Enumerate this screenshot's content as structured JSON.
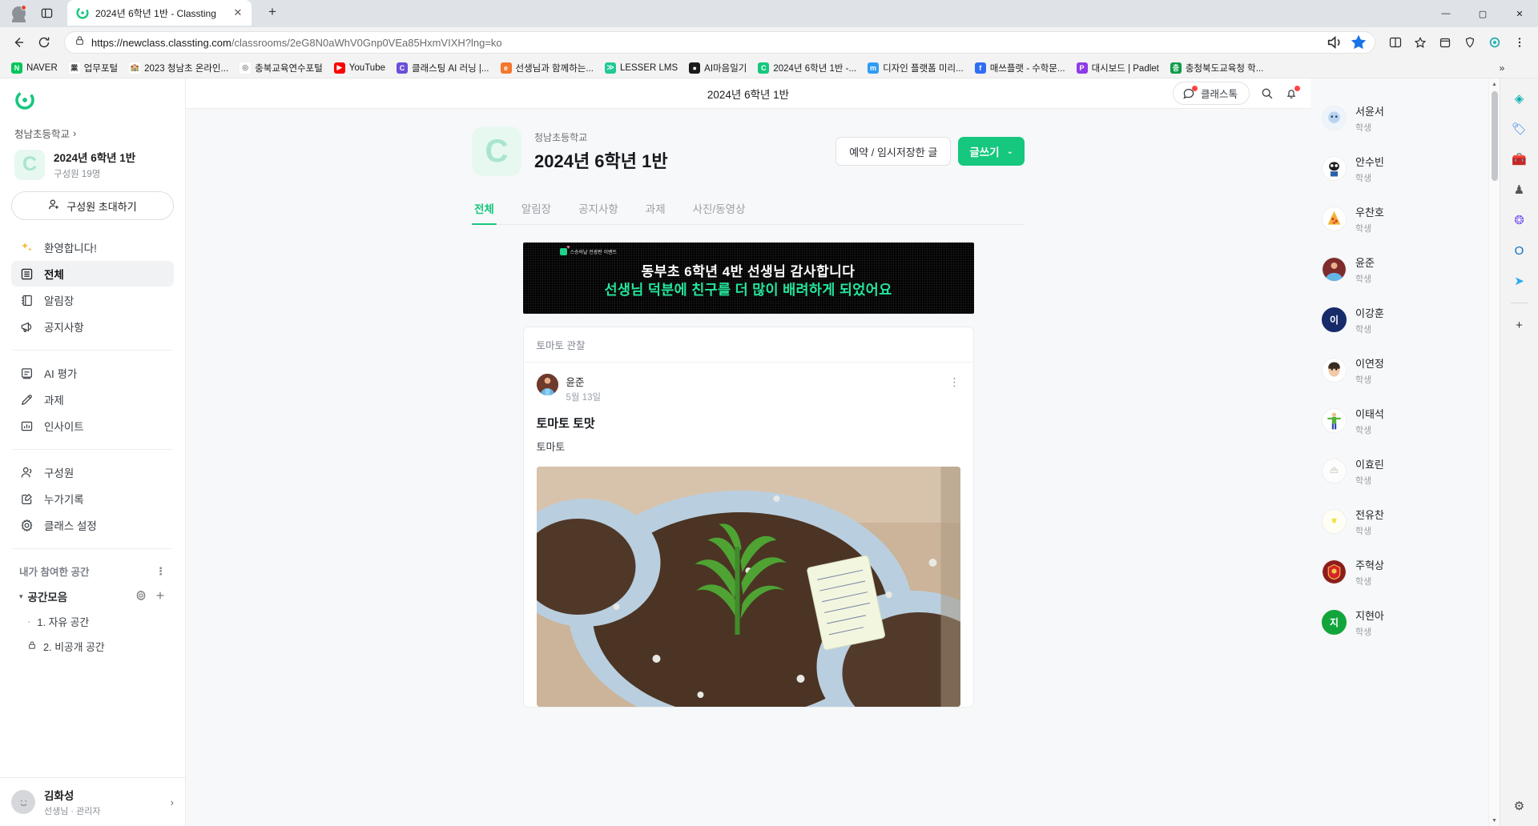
{
  "browser": {
    "tab": {
      "title": "2024년 6학년 1반 - Classting",
      "favicon": "classting-icon"
    },
    "newtab_label": "+",
    "window_controls": {
      "minimize": "—",
      "maximize": "▢",
      "close": "✕"
    },
    "url_secure": "https://newclass.classting.com",
    "url_path": "/classrooms/2eG8N0aWhV0Gnp0VEa85HxmVIXH?lng=ko",
    "bookmarks": [
      {
        "label": "NAVER",
        "icon": "naver-icon",
        "color": "#03c75a",
        "glyph": "N"
      },
      {
        "label": "업무포털",
        "icon": "portal-icon",
        "color": "#ffffff",
        "glyph": "業"
      },
      {
        "label": "2023 청남초 온라인...",
        "icon": "school-icon",
        "color": "#ffffff",
        "glyph": "🏫"
      },
      {
        "label": "충북교육연수포털",
        "icon": "chungbuk-icon",
        "color": "#ffffff",
        "glyph": "◎"
      },
      {
        "label": "YouTube",
        "icon": "youtube-icon",
        "color": "#ff0000",
        "glyph": "▶"
      },
      {
        "label": "클래스팅 AI 러닝 |...",
        "icon": "classting-ai-icon",
        "color": "#6b4fd8",
        "glyph": "C"
      },
      {
        "label": "선생님과 함께하는...",
        "icon": "teacher-icon",
        "color": "#f5762c",
        "glyph": "e"
      },
      {
        "label": "LESSER LMS",
        "icon": "lesser-icon",
        "color": "#20c997",
        "glyph": "≫"
      },
      {
        "label": "AI마음일기",
        "icon": "ai-diary-icon",
        "color": "#1b1b1b",
        "glyph": "●"
      },
      {
        "label": "2024년 6학년 1반 -...",
        "icon": "classting-icon",
        "color": "#16c77e",
        "glyph": "C"
      },
      {
        "label": "디자인 플랫폼 미리...",
        "icon": "miri-icon",
        "color": "#2f9cf4",
        "glyph": "m"
      },
      {
        "label": "매쓰플랫 - 수학문...",
        "icon": "mathflat-icon",
        "color": "#2f6df4",
        "glyph": "f"
      },
      {
        "label": "대시보드 | Padlet",
        "icon": "padlet-icon",
        "color": "#8e3ae8",
        "glyph": "P"
      },
      {
        "label": "충청북도교육청 학...",
        "icon": "cbe-icon",
        "color": "#0f9b4a",
        "glyph": "충"
      }
    ],
    "bookmarks_overflow": "»"
  },
  "edge_rail": {
    "icons": [
      {
        "name": "copilot-icon",
        "glyph": "◈",
        "color": "#10b0b0"
      },
      {
        "name": "shopping-tag-icon",
        "glyph": "🏷",
        "color": "#2f80ed"
      },
      {
        "name": "tools-icon",
        "glyph": "🧰",
        "color": "#d1552b"
      },
      {
        "name": "games-icon",
        "glyph": "♟",
        "color": "#555"
      },
      {
        "name": "microsoft365-icon",
        "glyph": "❂",
        "color": "#7b5cf0"
      },
      {
        "name": "outlook-icon",
        "glyph": "O",
        "color": "#0f6cbd"
      },
      {
        "name": "telegram-icon",
        "glyph": "➤",
        "color": "#2aabee"
      }
    ],
    "add_label": "+",
    "settings_glyph": "⚙"
  },
  "sidebar": {
    "logo": "classting-logo",
    "school": "청남초등학교",
    "school_chevron": "›",
    "class": {
      "thumb_letter": "C",
      "name": "2024년 6학년 1반",
      "members": "구성원 19명"
    },
    "invite_button": "구성원 초대하기",
    "nav_group_1": [
      {
        "label": "환영합니다!",
        "icon": "sparkles-icon",
        "active": false
      },
      {
        "label": "전체",
        "icon": "list-icon",
        "active": true
      },
      {
        "label": "알림장",
        "icon": "notebook-icon",
        "active": false
      },
      {
        "label": "공지사항",
        "icon": "megaphone-icon",
        "active": false
      }
    ],
    "nav_group_2": [
      {
        "label": "AI 평가",
        "icon": "assessment-icon",
        "active": false
      },
      {
        "label": "과제",
        "icon": "pencil-icon",
        "active": false
      },
      {
        "label": "인사이트",
        "icon": "chart-icon",
        "active": false
      }
    ],
    "nav_group_3": [
      {
        "label": "구성원",
        "icon": "people-icon",
        "active": false
      },
      {
        "label": "누가기록",
        "icon": "record-icon",
        "active": false
      },
      {
        "label": "클래스 설정",
        "icon": "gear-icon",
        "active": false
      }
    ],
    "spaces_header": "내가 참여한 공간",
    "spaces_kebab": "⋮",
    "space_group": "공간모음",
    "space_group_caret": "▾",
    "space_items": [
      {
        "label": "1. 자유 공간",
        "icon": "bullet"
      },
      {
        "label": "2. 비공개 공간",
        "icon": "lock-icon"
      }
    ],
    "user": {
      "name": "김화성",
      "role": "선생님 · 관리자",
      "chevron": "›"
    }
  },
  "topbar": {
    "title": "2024년 6학년 1반",
    "classtalk_label": "클래스톡",
    "search_icon": "search-icon",
    "bell_icon": "bell-icon"
  },
  "main": {
    "class_header": {
      "thumb_letter": "C",
      "school": "청남초등학교",
      "title": "2024년 6학년 1반",
      "draft_button": "예약 / 임시저장한 글",
      "write_button": "글쓰기",
      "write_caret": "⌄"
    },
    "tabs": [
      {
        "label": "전체",
        "active": true
      },
      {
        "label": "알림장",
        "active": false
      },
      {
        "label": "공지사항",
        "active": false
      },
      {
        "label": "과제",
        "active": false
      },
      {
        "label": "사진/동영상",
        "active": false
      }
    ],
    "banner": {
      "tag": "스승의날 전광판 이벤트",
      "line1": "동부초 6학년 4반 선생님 감사합니다",
      "line2": "선생님 덕분에 친구를 더 많이 배려하게 되었어요"
    },
    "post": {
      "category": "토마토 관찰",
      "author": "윤준",
      "date": "5월 13일",
      "more": "⋮",
      "title": "토마토 토맛",
      "text": "토마토",
      "photo_alt": "tomato-seedling-photo"
    }
  },
  "members": [
    {
      "name": "서윤서",
      "role": "학생",
      "avatar_type": "image",
      "color": "#eef3fb",
      "initial": ""
    },
    {
      "name": "안수빈",
      "role": "학생",
      "avatar_type": "image",
      "color": "#ffffff",
      "initial": ""
    },
    {
      "name": "우찬호",
      "role": "학생",
      "avatar_type": "image",
      "color": "#fff6e0",
      "initial": ""
    },
    {
      "name": "윤준",
      "role": "학생",
      "avatar_type": "image",
      "color": "#4a8fd0",
      "initial": ""
    },
    {
      "name": "이강훈",
      "role": "학생",
      "avatar_type": "initial",
      "color": "#172b6b",
      "initial": "이"
    },
    {
      "name": "이연정",
      "role": "학생",
      "avatar_type": "image",
      "color": "#ffffff",
      "initial": ""
    },
    {
      "name": "이태석",
      "role": "학생",
      "avatar_type": "image",
      "color": "#ffffff",
      "initial": ""
    },
    {
      "name": "이효린",
      "role": "학생",
      "avatar_type": "image",
      "color": "#fdfdfd",
      "initial": ""
    },
    {
      "name": "전유찬",
      "role": "학생",
      "avatar_type": "image",
      "color": "#fffdf2",
      "initial": ""
    },
    {
      "name": "주혁상",
      "role": "학생",
      "avatar_type": "image",
      "color": "#8d1d1d",
      "initial": ""
    },
    {
      "name": "지현아",
      "role": "학생",
      "avatar_type": "initial",
      "color": "#12a53c",
      "initial": "지"
    }
  ],
  "colors": {
    "brand_green": "#16c77e",
    "accent_red": "#ff4444",
    "sidebar_active": "#f1f2f4"
  }
}
